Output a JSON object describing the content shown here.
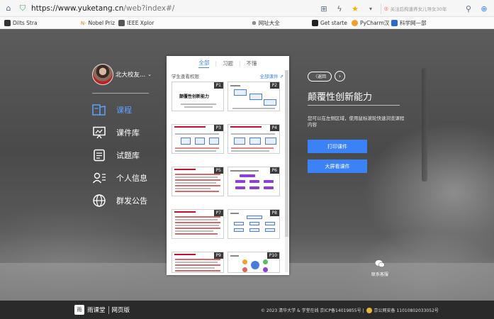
{
  "browser": {
    "url_scheme": "https://",
    "url_host": "www.yuketang.cn",
    "url_path": "/web?index#/",
    "search_placeholder": "关注后拘速养女儿导女30年"
  },
  "bookmarks": [
    {
      "label": "Dilts Stra"
    },
    {
      "label": "Nobel Priz"
    },
    {
      "label": "IEEE Xplor"
    },
    {
      "label": "网址大全"
    },
    {
      "label": "Get starte"
    },
    {
      "label": "PyCharm汉"
    },
    {
      "label": "科学网—部"
    }
  ],
  "sidebar": {
    "profile_name": "北大校友...",
    "items": [
      {
        "label": "课程",
        "icon": "book-icon",
        "active": true
      },
      {
        "label": "课件库",
        "icon": "slides-icon",
        "active": false
      },
      {
        "label": "试题库",
        "icon": "list-icon",
        "active": false
      },
      {
        "label": "个人信息",
        "icon": "person-icon",
        "active": false
      },
      {
        "label": "群发公告",
        "icon": "globe-icon",
        "active": false
      }
    ]
  },
  "panel": {
    "tabs": [
      {
        "label": "全部",
        "active": true
      },
      {
        "label": "习题",
        "active": false
      },
      {
        "label": "不懂",
        "active": false
      }
    ],
    "permission_label": "学生查看权限",
    "all_slides_link": "全部课件 ⇗",
    "slides": [
      {
        "page": "P1",
        "title": "颠覆性创新能力"
      },
      {
        "page": "P2"
      },
      {
        "page": "P3"
      },
      {
        "page": "P4"
      },
      {
        "page": "P5"
      },
      {
        "page": "P6"
      },
      {
        "page": "P7"
      },
      {
        "page": "P8"
      },
      {
        "page": "P9"
      },
      {
        "page": "P10"
      }
    ]
  },
  "course": {
    "back_label": "返回",
    "title": "颠覆性创新能力",
    "desc": "您可以在左侧区域，使用鼠标滚轮快速浏览课程内容",
    "print_button": "打印课件",
    "bigscreen_button": "大屏看课件"
  },
  "wechat_label": "联系客服",
  "footer": {
    "logo_text": "雨课堂",
    "web_label": "网页版",
    "copyright": "© 2023 清华大学 & 学堂在线 京ICP备14019855号 | ",
    "police_text": "京公网安备 11010802033052号"
  },
  "colors": {
    "accent": "#3b82f6",
    "footer_bg": "#2a2a2a",
    "slide_red": "#c8102e",
    "slide_purple": "#8e3fd6"
  }
}
